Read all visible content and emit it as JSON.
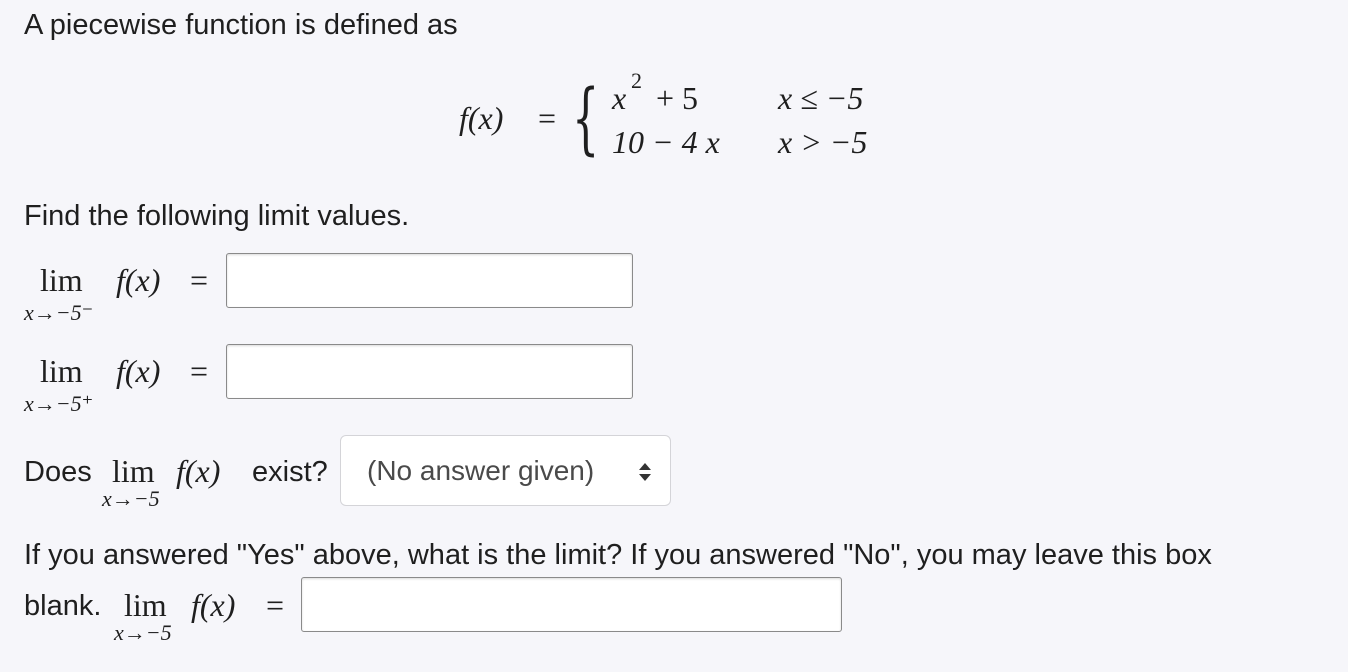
{
  "intro": "A piecewise function is defined as",
  "piecewise": {
    "lhs": "f(x)",
    "eq": "=",
    "case1_expr_base": "x",
    "case1_expr_exp": "2",
    "case1_expr_rest": "+ 5",
    "case1_cond": "x ≤ −5",
    "case2_expr": "10 − 4 x",
    "case2_cond": "x > −5"
  },
  "prompt": "Find the following limit values.",
  "q1": {
    "lim": "lim",
    "sub": "x→−5⁻",
    "func": "f(x)",
    "eq": "=",
    "value": ""
  },
  "q2": {
    "lim": "lim",
    "sub": "x→−5⁺",
    "func": "f(x)",
    "eq": "=",
    "value": ""
  },
  "q3": {
    "pre": "Does",
    "lim": "lim",
    "sub": "x→−5",
    "func": "f(x)",
    "post": "exist?",
    "select_value": "(No answer given)",
    "select_icon": "updown-chevron-icon"
  },
  "q4": {
    "text": "If you answered \"Yes\" above, what is the limit? If you answered \"No\", you may leave this box",
    "pre": "blank.",
    "lim": "lim",
    "sub": "x→−5",
    "func": "f(x)",
    "eq": "=",
    "value": ""
  }
}
